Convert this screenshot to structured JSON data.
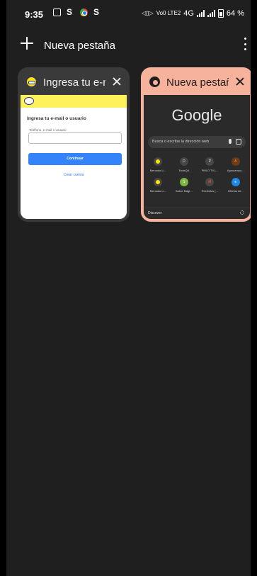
{
  "status_bar": {
    "time": "9:35",
    "network_label": "4G",
    "volte_label": "Vo0 LTE2",
    "battery_percent": "64 %"
  },
  "toolbar": {
    "title": "Nueva pestaña",
    "new_tab_icon": "plus-icon",
    "menu_icon": "more-vert-icon"
  },
  "tabs": [
    {
      "title": "Ingresa tu e-mail o usuario",
      "favicon": "mercadolibre-icon",
      "preview": {
        "heading": "Ingresa tu e-mail o usuario",
        "field_label": "Teléfono, e-mail o usuario",
        "button": "Continuar",
        "link": "Crear cuenta"
      }
    },
    {
      "title": "Nueva pestaña",
      "favicon": "chrome-icon",
      "accent": "#f7b29c",
      "preview": {
        "logo": "Google",
        "search_placeholder": "Busca o escribe la dirección web",
        "shortcuts": [
          {
            "label": "Mercado Li...",
            "icon": "mercadolibre-icon",
            "color": "#ffe600"
          },
          {
            "label": "ToolsQA",
            "icon": "toolsqa-icon",
            "letter": "D",
            "color": "#555555"
          },
          {
            "label": "PMLO TV |...",
            "icon": "pmlo-icon",
            "letter": "P",
            "color": "#777777"
          },
          {
            "label": "Agrocampo...",
            "icon": "agrocampo-icon",
            "letter": "A",
            "color": "#e65100"
          },
          {
            "label": "Mercado Li...",
            "icon": "mercadolibre-icon",
            "color": "#ffe600"
          },
          {
            "label": "Sabor Mági...",
            "icon": "sabor-icon",
            "letter": "S",
            "color": "#7cb342"
          },
          {
            "label": "Recibidos (...",
            "icon": "gmail-icon",
            "letter": "M",
            "color": "#ea4335"
          },
          {
            "label": "Ofertas de...",
            "icon": "ofertas-icon",
            "letter": "e",
            "color": "#1e88e5"
          }
        ],
        "discover_label": "Discover"
      }
    }
  ]
}
